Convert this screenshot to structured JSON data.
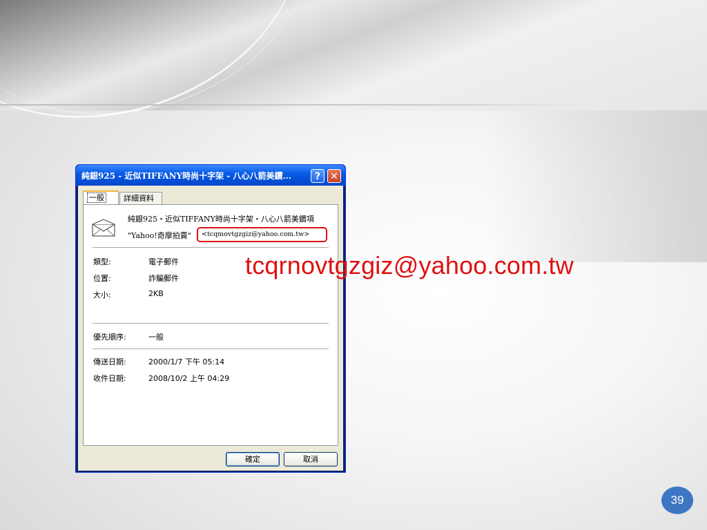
{
  "dialog": {
    "title": "純銀925 - 近似TIFFANY時尚十字架 - 八心八箭美鑽...",
    "help_button": "?",
    "close_button": "✕",
    "tabs": [
      {
        "label": "一般"
      },
      {
        "label": "詳細資料"
      }
    ],
    "subject": "純銀925・近似TIFFANY時尚十字架・八心八箭美鑽項",
    "sender_name": "\"Yahoo!奇摩拍賣\"",
    "sender_address": "<tcqmovtgzgiz@yahoo.com.tw>",
    "fields": [
      {
        "label": "類型:",
        "value": "電子郵件"
      },
      {
        "label": "位置:",
        "value": "詐騙郵件"
      },
      {
        "label": "大小:",
        "value": "2KB"
      }
    ],
    "priority": {
      "label": "優先順序:",
      "value": "一般"
    },
    "dates": [
      {
        "label": "傳送日期:",
        "value": "2000/1/7 下午 05:14"
      },
      {
        "label": "收件日期:",
        "value": "2008/10/2 上午 04:29"
      }
    ],
    "ok_label": "確定",
    "cancel_label": "取消"
  },
  "callout_text": "tcqrnovtgzgiz@yahoo.com.tw",
  "page_number": "39",
  "icons": {
    "envelope": "envelope-icon"
  },
  "colors": {
    "highlight": "#e01010",
    "title_bar": "#0350d8",
    "page_badge": "#3e76c3"
  }
}
